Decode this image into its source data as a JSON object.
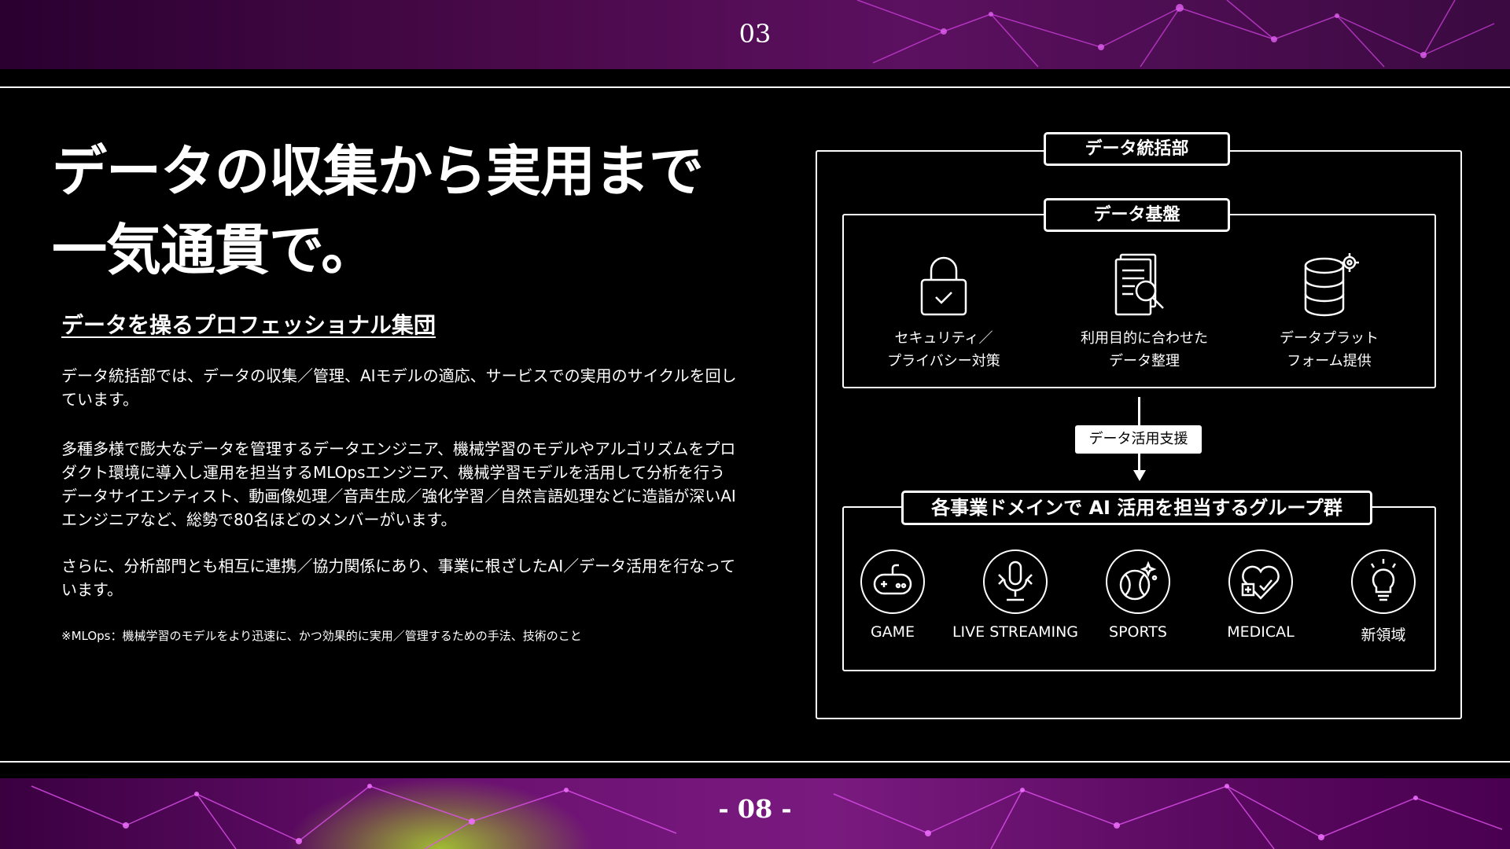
{
  "header": {
    "section_number": "03"
  },
  "footer": {
    "page_number": "- 08 -"
  },
  "headline": {
    "line1": "データの収集から実用まで",
    "line2": "一気通貫で。"
  },
  "subheading": "データを操るプロフェッショナル集団",
  "paragraphs": [
    "データ統括部では、データの収集／管理、AIモデルの適応、サービスでの実用のサイクルを回しています。",
    "多種多様で膨大なデータを管理するデータエンジニア、機械学習のモデルやアルゴリズムをプロダクト環境に導入し運用を担当するMLOpsエンジニア、機械学習モデルを活用して分析を行うデータサイエンティスト、動画像処理／音声生成／強化学習／自然言語処理などに造詣が深いAIエンジニアなど、総勢で80名ほどのメンバーがいます。",
    "さらに、分析部門とも相互に連携／協力関係にあり、事業に根ざしたAI／データ活用を行なっています。"
  ],
  "footnote": "※MLOps：機械学習のモデルをより迅速に、かつ効果的に実用／管理するための手法、技術のこと",
  "diagram": {
    "department_title": "データ統括部",
    "platform_title": "データ基盤",
    "platform_features": [
      {
        "icon": "padlock-check-icon",
        "line1": "セキュリティ／",
        "line2": "プライバシー対策"
      },
      {
        "icon": "documents-magnifier-icon",
        "line1": "利用目的に合わせた",
        "line2": "データ整理"
      },
      {
        "icon": "database-gear-icon",
        "line1": "データプラット",
        "line2": "フォーム提供"
      }
    ],
    "support_label": "データ活用支援",
    "groups_title": "各事業ドメインで AI 活用を担当するグループ群",
    "domains": [
      {
        "icon": "gamepad-icon",
        "label": "GAME"
      },
      {
        "icon": "microphone-icon",
        "label": "LIVE STREAMING"
      },
      {
        "icon": "baseball-icon",
        "label": "SPORTS"
      },
      {
        "icon": "heart-cross-icon",
        "label": "MEDICAL"
      },
      {
        "icon": "lightbulb-icon",
        "label": "新領域"
      }
    ]
  },
  "colors": {
    "background": "#000000",
    "text": "#ffffff",
    "band_purple": "#5c1060",
    "band_glow": "#aadc28",
    "network_lines": "#d040e0"
  }
}
